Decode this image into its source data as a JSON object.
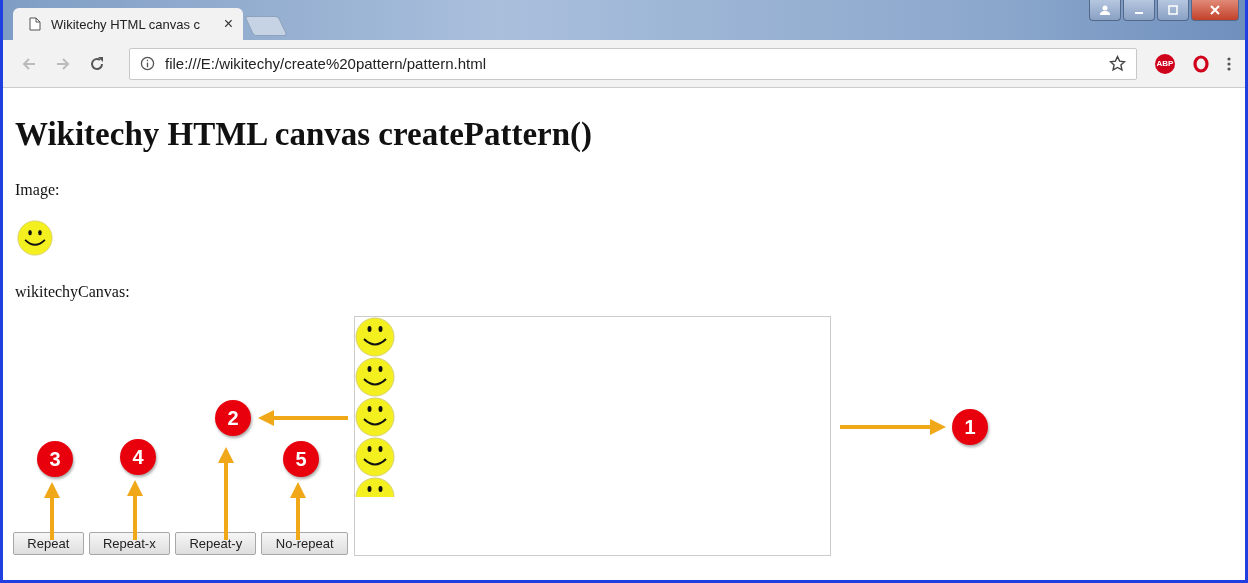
{
  "browser": {
    "tab": {
      "title": "Wikitechy HTML canvas c",
      "close": "×"
    },
    "address": "file:///E:/wikitechy/create%20pattern/pattern.html",
    "extension_badge": "ABP"
  },
  "page": {
    "heading": "Wikitechy HTML canvas createPattern()",
    "image_label": "Image:",
    "canvas_label": "wikitechyCanvas:",
    "buttons": [
      "Repeat",
      "Repeat-x",
      "Repeat-y",
      "No-repeat"
    ]
  },
  "callouts": [
    {
      "label": "1"
    },
    {
      "label": "2"
    },
    {
      "label": "3"
    },
    {
      "label": "4"
    },
    {
      "label": "5"
    }
  ]
}
